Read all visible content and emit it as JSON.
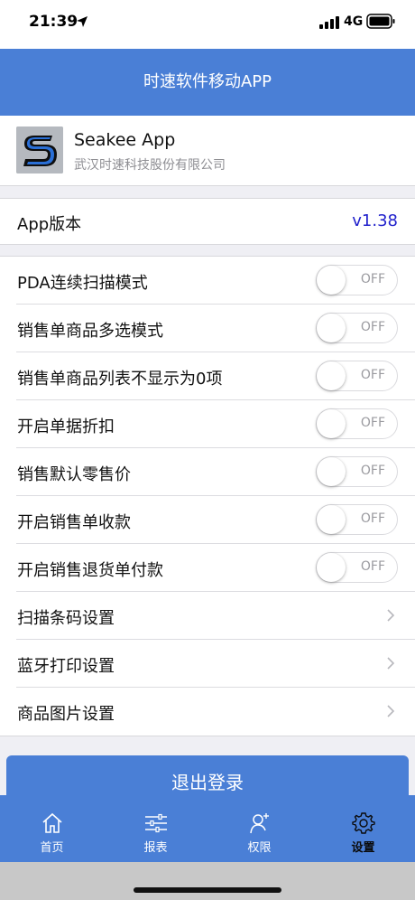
{
  "status_bar": {
    "time": "21:39",
    "network": "4G"
  },
  "nav": {
    "title": "时速软件移动APP"
  },
  "app_info": {
    "name": "Seakee App",
    "company": "武汉时速科技股份有限公司"
  },
  "version": {
    "label": "App版本",
    "value": "v1.38"
  },
  "settings": [
    {
      "label": "PDA连续扫描模式",
      "type": "toggle",
      "state": "OFF"
    },
    {
      "label": "销售单商品多选模式",
      "type": "toggle",
      "state": "OFF"
    },
    {
      "label": "销售单商品列表不显示为0项",
      "type": "toggle",
      "state": "OFF"
    },
    {
      "label": "开启单据折扣",
      "type": "toggle",
      "state": "OFF"
    },
    {
      "label": "销售默认零售价",
      "type": "toggle",
      "state": "OFF"
    },
    {
      "label": "开启销售单收款",
      "type": "toggle",
      "state": "OFF"
    },
    {
      "label": "开启销售退货单付款",
      "type": "toggle",
      "state": "OFF"
    },
    {
      "label": "扫描条码设置",
      "type": "link"
    },
    {
      "label": "蓝牙打印设置",
      "type": "link"
    },
    {
      "label": "商品图片设置",
      "type": "link"
    }
  ],
  "logout": {
    "label": "退出登录"
  },
  "tabbar": {
    "active": "设置",
    "tabs": [
      {
        "label": "首页",
        "icon": "home-icon"
      },
      {
        "label": "报表",
        "icon": "sliders-icon"
      },
      {
        "label": "权限",
        "icon": "user-add-icon"
      },
      {
        "label": "设置",
        "icon": "gear-icon"
      }
    ]
  },
  "colors": {
    "primary": "#4a7fd6",
    "version_text": "#2222cc",
    "background": "#efeff4"
  }
}
